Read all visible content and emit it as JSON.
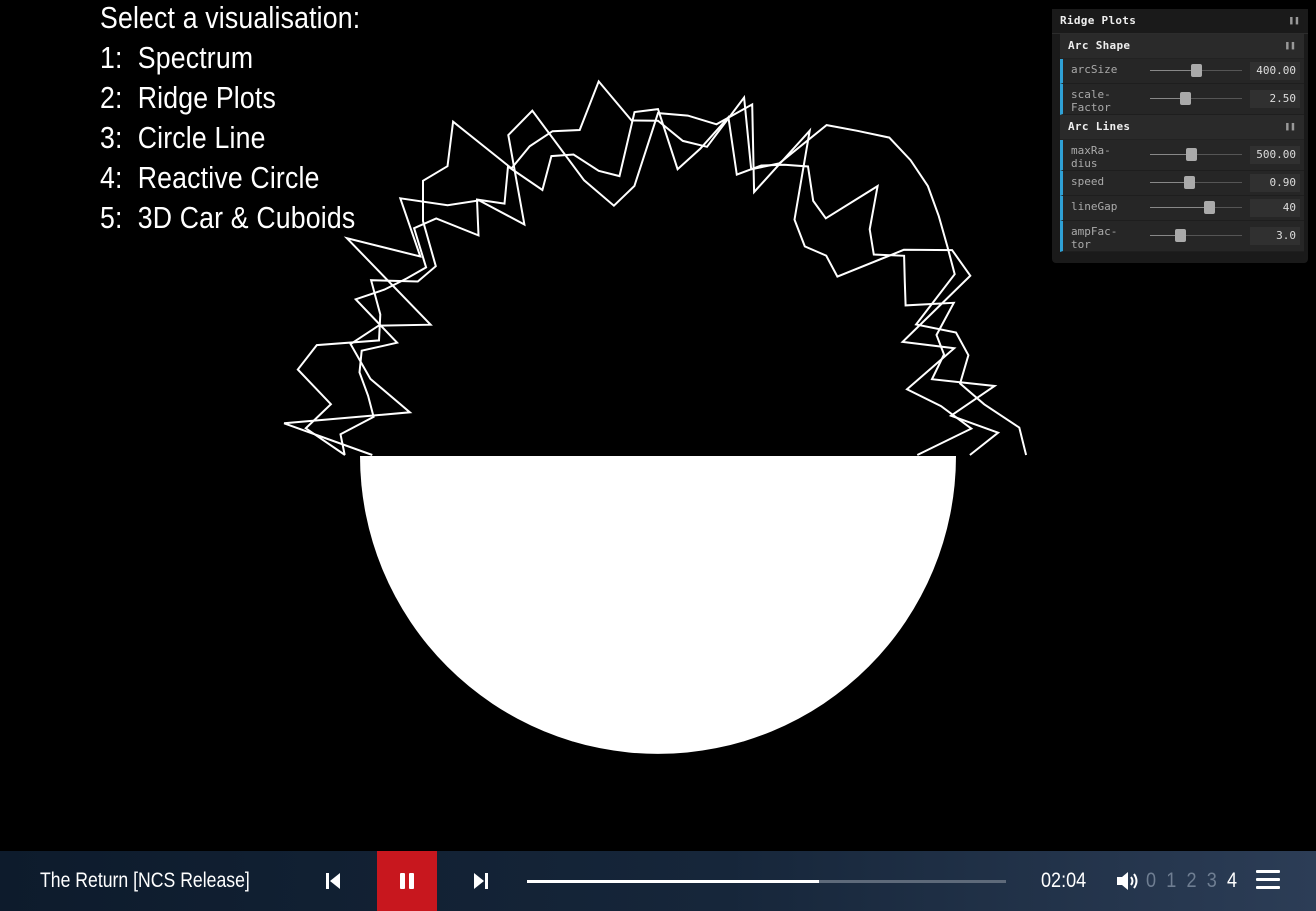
{
  "menu": {
    "heading": "Select a visualisation:",
    "items": [
      "1:  Spectrum",
      "2:  Ridge Plots",
      "3:  Circle Line",
      "4:  Reactive Circle",
      "5:  3D Car & Cuboids"
    ]
  },
  "gui": {
    "title": "Ridge Plots",
    "folders": [
      {
        "title": "Arc Shape",
        "controls": [
          {
            "label": "arcSize",
            "value": "400.00",
            "level": 0.5
          },
          {
            "label": "scale-Factor",
            "value": "2.50",
            "level": 0.38
          }
        ]
      },
      {
        "title": "Arc Lines",
        "controls": [
          {
            "label": "maxRa-dius",
            "value": "500.00",
            "level": 0.45
          },
          {
            "label": "speed",
            "value": "0.90",
            "level": 0.42
          },
          {
            "label": "lineGap",
            "value": "40",
            "level": 0.64
          },
          {
            "label": "ampFac-tor",
            "value": "3.0",
            "level": 0.33
          }
        ]
      }
    ]
  },
  "player": {
    "track_title": "The Return [NCS Release]",
    "time": "02:04",
    "progress": 0.61,
    "volume_levels": [
      "0",
      "1",
      "2",
      "3",
      "4"
    ],
    "volume_active": 4,
    "accent_color": "#c8171e"
  },
  "icons": {
    "prev": "skip-previous-icon",
    "pause": "pause-icon",
    "next": "skip-next-icon",
    "volume": "volume-icon",
    "menu": "hamburger-menu-icon"
  }
}
